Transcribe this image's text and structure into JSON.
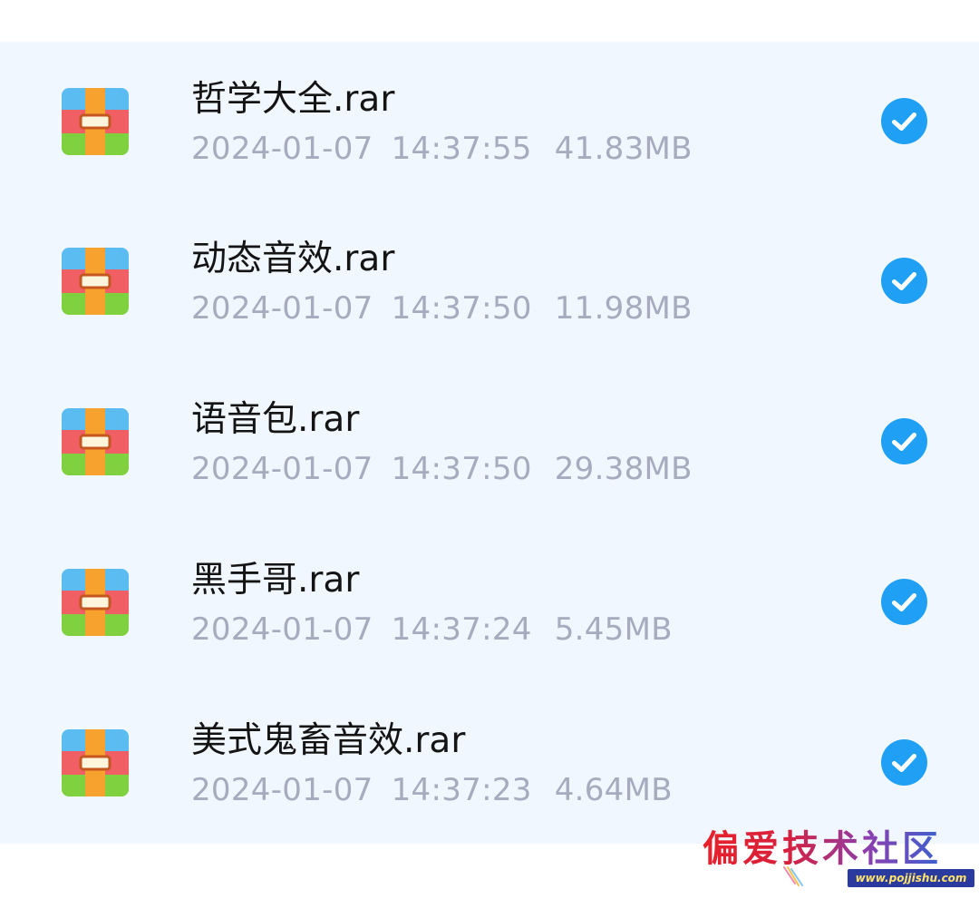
{
  "file_list": {
    "items": [
      {
        "name": "哲学大全.rar",
        "date": "2024-01-07",
        "time": "14:37:55",
        "size": "41.83MB",
        "icon": "archive-icon",
        "selected": true
      },
      {
        "name": "动态音效.rar",
        "date": "2024-01-07",
        "time": "14:37:50",
        "size": "11.98MB",
        "icon": "archive-icon",
        "selected": true
      },
      {
        "name": "语音包.rar",
        "date": "2024-01-07",
        "time": "14:37:50",
        "size": "29.38MB",
        "icon": "archive-icon",
        "selected": true
      },
      {
        "name": "黑手哥.rar",
        "date": "2024-01-07",
        "time": "14:37:24",
        "size": "5.45MB",
        "icon": "archive-icon",
        "selected": true
      },
      {
        "name": "美式鬼畜音效.rar",
        "date": "2024-01-07",
        "time": "14:37:23",
        "size": "4.64MB",
        "icon": "archive-icon",
        "selected": true
      }
    ]
  },
  "watermark": {
    "title": "偏爱技术社区",
    "url": "www.pojjishu.com"
  },
  "colors": {
    "list_background": "#f1f7fe",
    "check_blue": "#1fa0f5",
    "meta_gray": "#a6abbe",
    "name_text": "#141414"
  }
}
